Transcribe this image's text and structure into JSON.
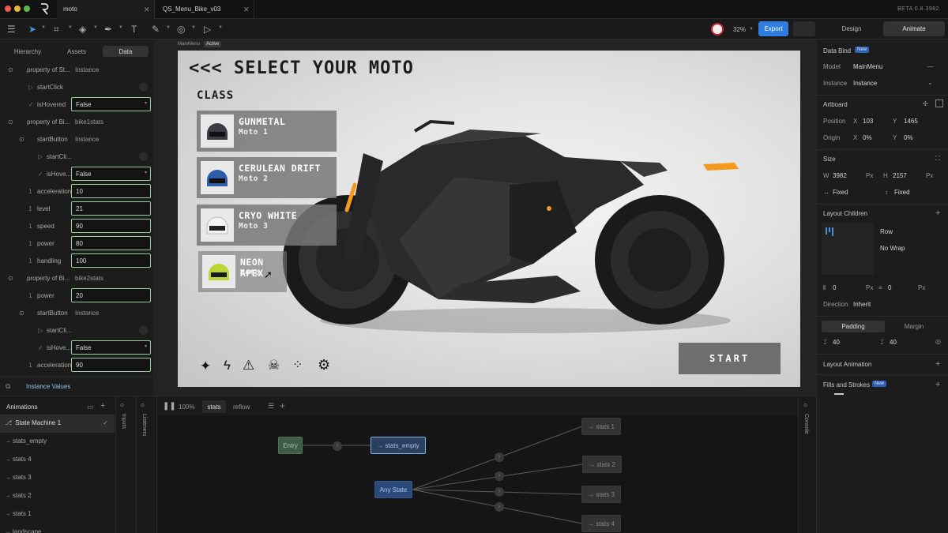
{
  "titlebar": {
    "tabs": [
      {
        "label": "moto"
      },
      {
        "label": "QS_Menu_Bike_v03"
      }
    ],
    "version": "BETA 0.8.3982"
  },
  "toolbar": {
    "zoom": "32%",
    "export_label": "Export",
    "design_label": "Design",
    "animate_label": "Animate"
  },
  "left_panel": {
    "tabs": [
      "Hierarchy",
      "Assets",
      "Data"
    ],
    "rows": [
      {
        "label": "property of St...",
        "side": "Instance"
      },
      {
        "label": "startClick"
      },
      {
        "label": "isHovered",
        "value": "False",
        "dropdown": true
      },
      {
        "label": "property of Bi...",
        "side": "bike1stats"
      },
      {
        "label": "startButton",
        "side": "Instance"
      },
      {
        "label": "startCli..."
      },
      {
        "label": "isHove...",
        "value": "False",
        "dropdown": true
      },
      {
        "label": "acceleration",
        "value": "10"
      },
      {
        "label": "level",
        "value": "21"
      },
      {
        "label": "speed",
        "value": "90"
      },
      {
        "label": "power",
        "value": "80"
      },
      {
        "label": "handling",
        "value": "100"
      },
      {
        "label": "property of Bi...",
        "side": "bike2stats"
      },
      {
        "label": "power",
        "value": "20"
      },
      {
        "label": "startButton",
        "side": "Instance"
      },
      {
        "label": "startCli..."
      },
      {
        "label": "isHove...",
        "value": "False",
        "dropdown": true
      },
      {
        "label": "acceleration",
        "value": "90"
      }
    ],
    "instance_values": "Instance Values"
  },
  "canvas": {
    "artboard_label": "MainMenu",
    "artboard_badge": "Active",
    "title": "<<< SELECT YOUR MOTO",
    "class_label": "CLASS",
    "cards": [
      {
        "name": "GUNMETAL",
        "sub": "Moto 1",
        "helmet_color": "#3a3d44"
      },
      {
        "name": "CERULEAN DRIFT",
        "sub": "Moto 2",
        "helmet_color": "#2d5da8"
      },
      {
        "name": "CRYO WHITE",
        "sub": "Moto 3",
        "helmet_color": "#e8e8e8"
      },
      {
        "name": "NEON APEX",
        "sub": "Moto",
        "helmet_color": "#b9d633"
      }
    ],
    "start_label": "START",
    "accent_color": "#f39a1c"
  },
  "right_panel": {
    "data_bind": {
      "title": "Data Bind",
      "badge": "New",
      "model_label": "Model",
      "model_value": "MainMenu",
      "instance_label": "Instance",
      "instance_value": "Instance"
    },
    "artboard": {
      "title": "Artboard",
      "position_label": "Position",
      "x_label": "X",
      "x": "103",
      "y_label": "Y",
      "y": "1465",
      "origin_label": "Origin",
      "ox": "0%",
      "oy": "0%"
    },
    "size": {
      "title": "Size",
      "w_label": "W",
      "w": "3982",
      "h_label": "H",
      "h": "2157",
      "unit": "Px",
      "w_mode": "Fixed",
      "h_mode": "Fixed"
    },
    "layout_children": {
      "title": "Layout Children",
      "direction_value": "Row",
      "wrap_value": "No Wrap",
      "gap_x": "0",
      "gap_y": "0",
      "unit": "Px",
      "direction_label": "Direction",
      "direction": "Inherit"
    },
    "padding": {
      "tab_padding": "Padding",
      "tab_margin": "Margin",
      "a": "40",
      "b": "40"
    },
    "layout_animation": "Layout Animation",
    "fills": {
      "title": "Fills and Strokes",
      "badge": "New"
    }
  },
  "bottom": {
    "animations_title": "Animations",
    "list": [
      "State Machine 1",
      "stats_empty",
      "stats 4",
      "stats 3",
      "stats 2",
      "stats 1",
      "landscape"
    ],
    "side_tabs": [
      "Inputs",
      "Listeners"
    ],
    "zoom": "100%",
    "tabs": [
      "stats",
      "reflow"
    ],
    "console_label": "Console",
    "nodes": {
      "entry": "Entry",
      "stats_empty": "stats_empty",
      "any_state": "Any State",
      "s1": "stats 1",
      "s2": "stats 2",
      "s3": "stats 3",
      "s4": "stats 4"
    }
  }
}
